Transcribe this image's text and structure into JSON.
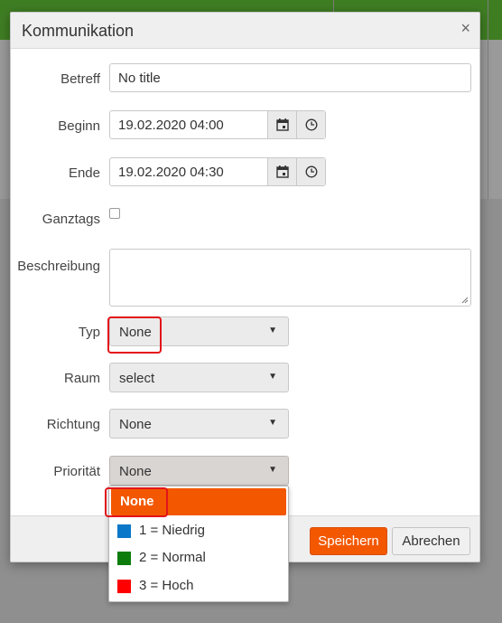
{
  "dialog": {
    "title": "Kommunikation",
    "close_glyph": "×",
    "close_icon": "close-icon"
  },
  "form": {
    "subject": {
      "label": "Betreff",
      "value": "No title"
    },
    "start": {
      "label": "Beginn",
      "value": "19.02.2020 04:00",
      "calendar_icon": "calendar-icon",
      "clock_icon": "clock-icon"
    },
    "end": {
      "label": "Ende",
      "value": "19.02.2020 04:30",
      "calendar_icon": "calendar-icon",
      "clock_icon": "clock-icon"
    },
    "all_day": {
      "label": "Ganztags",
      "checked": false
    },
    "description": {
      "label": "Beschreibung",
      "value": ""
    },
    "type": {
      "label": "Typ",
      "value": "None"
    },
    "room": {
      "label": "Raum",
      "value": "select"
    },
    "direction": {
      "label": "Richtung",
      "value": "None"
    },
    "priority": {
      "label": "Priorität",
      "value": "None"
    },
    "arrow_glyph": "▼"
  },
  "priority_dropdown": {
    "options": [
      {
        "label": "None",
        "color": null,
        "selected": true
      },
      {
        "label": "1 = Niedrig",
        "color": "#0a77c9",
        "selected": false
      },
      {
        "label": "2 = Normal",
        "color": "#0c7d0c",
        "selected": false
      },
      {
        "label": "3 = Hoch",
        "color": "#ff0000",
        "selected": false
      }
    ]
  },
  "footer": {
    "save_label": "Speichern",
    "cancel_label": "Abrechen"
  },
  "colors": {
    "accent": "#f35800",
    "annotation": "#e3141a",
    "topbar": "#3f7d23"
  }
}
